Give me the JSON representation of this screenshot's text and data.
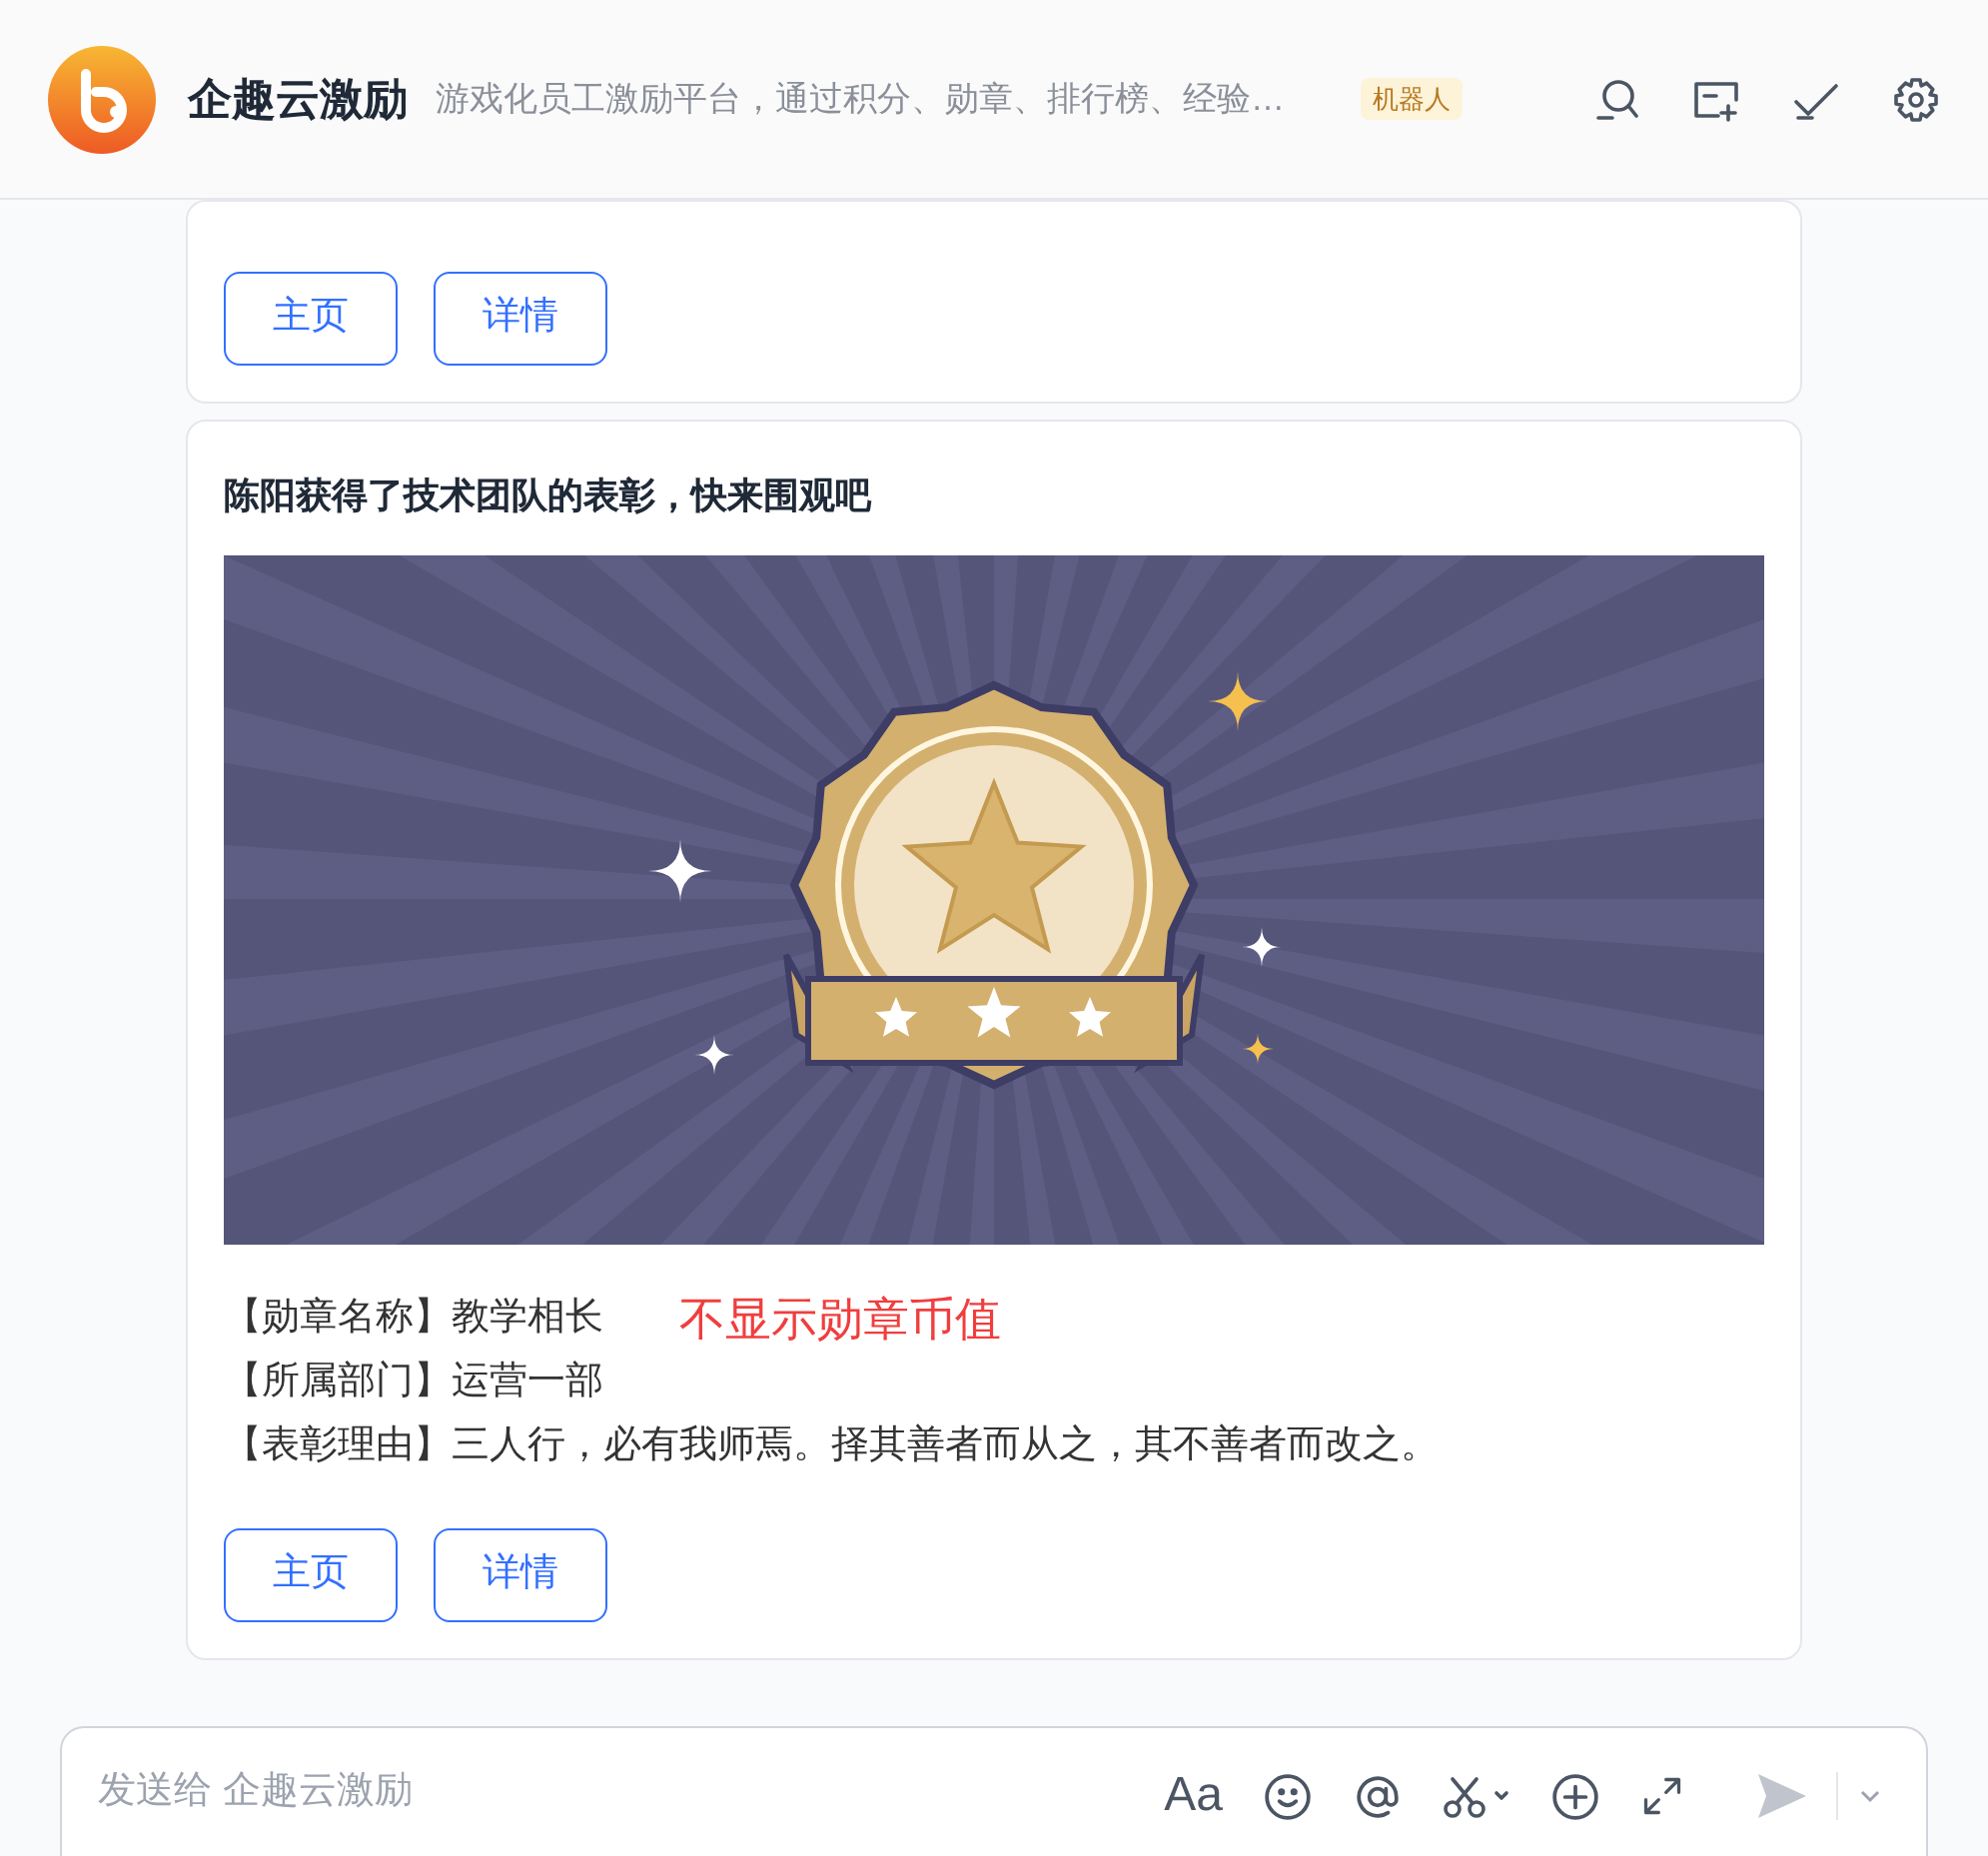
{
  "header": {
    "app_name": "企趣云激励",
    "description": "游戏化员工激励平台，通过积分、勋章、排行榜、经验…",
    "tag": "机器人"
  },
  "messages": [
    {
      "buttons": [
        "主页",
        "详情"
      ]
    },
    {
      "title": "陈阳获得了技术团队的表彰，快来围观吧",
      "fields": [
        {
          "label": "【勋章名称】",
          "value": "教学相长",
          "note": "不显示勋章币值"
        },
        {
          "label": "【所属部门】",
          "value": "运营一部"
        },
        {
          "label": "【表彰理由】",
          "value": "三人行，必有我师焉。择其善者而从之，其不善者而改之。"
        }
      ],
      "buttons": [
        "主页",
        "详情"
      ]
    }
  ],
  "composer": {
    "placeholder": "发送给 企趣云激励",
    "format_label": "Aa"
  }
}
